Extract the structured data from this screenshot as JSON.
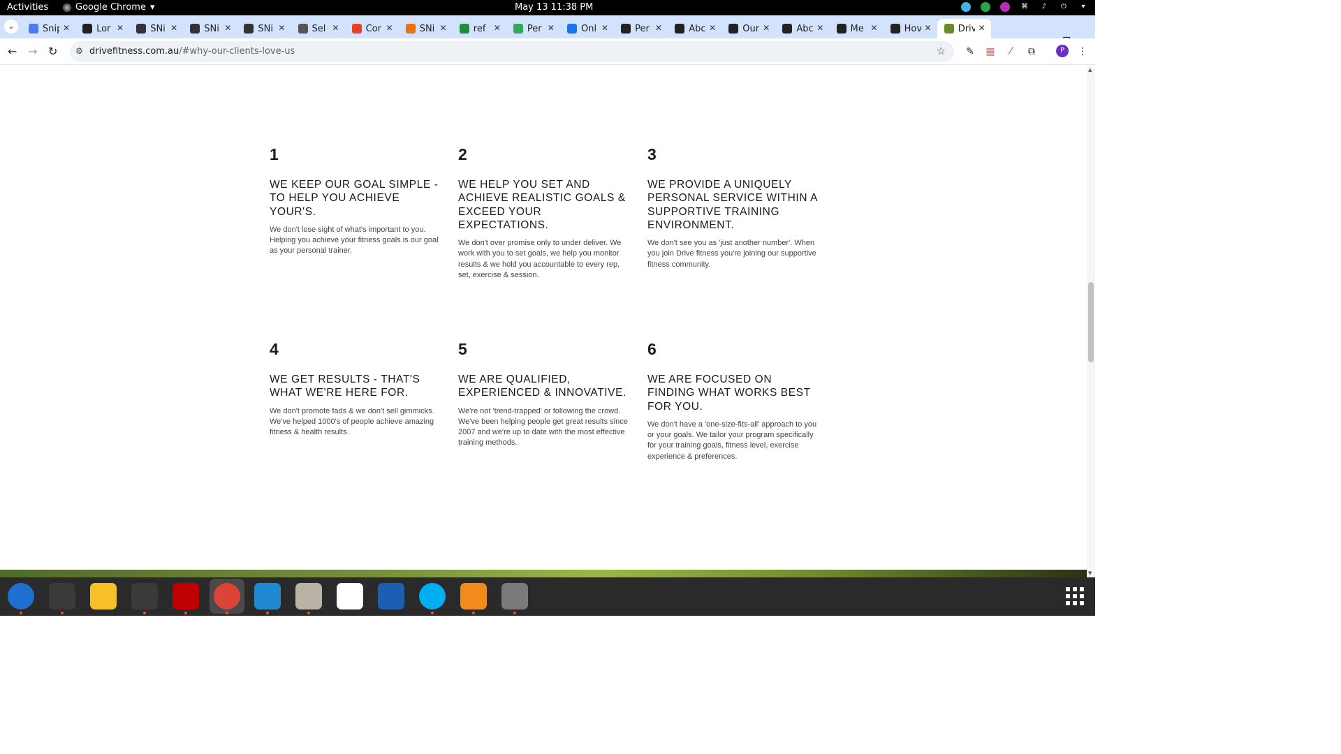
{
  "system_bar": {
    "activities": "Activities",
    "app_name": "Google Chrome",
    "clock": "May 13  11:38 PM"
  },
  "tabs": [
    {
      "label": "Snip",
      "favicon_color": "#4a7cf0"
    },
    {
      "label": "Lor",
      "favicon_color": "#222222"
    },
    {
      "label": "SNi",
      "favicon_color": "#333333"
    },
    {
      "label": "SNi",
      "favicon_color": "#333333"
    },
    {
      "label": "SNi",
      "favicon_color": "#333333"
    },
    {
      "label": "Sel",
      "favicon_color": "#555555"
    },
    {
      "label": "Cor",
      "favicon_color": "#e24329"
    },
    {
      "label": "SNi",
      "favicon_color": "#e9720e"
    },
    {
      "label": "ref",
      "favicon_color": "#1e8e3e"
    },
    {
      "label": "Per",
      "favicon_color": "#34a853"
    },
    {
      "label": "Onl",
      "favicon_color": "#1a73e8"
    },
    {
      "label": "Per",
      "favicon_color": "#222222"
    },
    {
      "label": "Abc",
      "favicon_color": "#222222"
    },
    {
      "label": "Our",
      "favicon_color": "#222222"
    },
    {
      "label": "Abc",
      "favicon_color": "#222222"
    },
    {
      "label": "Me",
      "favicon_color": "#222222"
    },
    {
      "label": "Hov",
      "favicon_color": "#222222"
    },
    {
      "label": "Driv",
      "favicon_color": "#6a8a2a",
      "active": true
    }
  ],
  "address_bar": {
    "domain": "drivefitness.com.au",
    "path": "/#why-our-clients-love-us"
  },
  "profile_initial": "P",
  "features": [
    {
      "number": "1",
      "heading": "WE KEEP OUR GOAL SIMPLE - TO HELP YOU ACHIEVE YOUR'S.",
      "body": "We don't lose sight of what's important to you. Helping you achieve your fitness goals is our goal as your personal trainer."
    },
    {
      "number": "2",
      "heading": "WE HELP YOU SET AND ACHIEVE REALISTIC GOALS & EXCEED YOUR EXPECTATIONS.",
      "body": "We don't over promise only to under deliver. We work with you to set goals, we help you monitor results & we hold you accountable to every rep, set, exercise & session."
    },
    {
      "number": "3",
      "heading": "WE PROVIDE A UNIQUELY PERSONAL SERVICE WITHIN A SUPPORTIVE TRAINING ENVIRONMENT.",
      "body": "We don't see you as 'just another number'. When you join Drive fitness you're joining our supportive fitness community."
    },
    {
      "number": "4",
      "heading": "WE GET RESULTS - THAT'S WHAT WE'RE HERE FOR.",
      "body": "We don't promote fads & we don't sell gimmicks. We've helped 1000's of people achieve amazing fitness & health results."
    },
    {
      "number": "5",
      "heading": "WE ARE QUALIFIED, EXPERIENCED & INNOVATIVE.",
      "body": "We're not 'trend-trapped' or following the crowd. We've been helping people get great results since 2007 and we're up to date with the most effective training methods."
    },
    {
      "number": "6",
      "heading": "WE ARE FOCUSED ON FINDING WHAT WORKS BEST FOR YOU.",
      "body": "We don't have a 'one-size-fits-all' approach to you or your goals. We tailor your program specifically for your training goals, fitness level, exercise experience & preferences."
    }
  ],
  "dock": [
    {
      "name": "thunderbird",
      "color": "#1f6fd0",
      "running": true
    },
    {
      "name": "terminal",
      "color": "#3a3a3a",
      "running": true
    },
    {
      "name": "notes",
      "color": "#f6c026",
      "running": false
    },
    {
      "name": "system-monitor",
      "color": "#3a3a3a",
      "running": true
    },
    {
      "name": "filezilla",
      "color": "#bf0000",
      "running": true
    },
    {
      "name": "chrome",
      "color": "#db4437",
      "running": true,
      "selected": true
    },
    {
      "name": "vscode",
      "color": "#1f8ad2",
      "running": true
    },
    {
      "name": "files",
      "color": "#b9b3a6",
      "running": true
    },
    {
      "name": "text-editor",
      "color": "#ffffff",
      "running": false
    },
    {
      "name": "writer",
      "color": "#1b5fb2",
      "running": false
    },
    {
      "name": "skype",
      "color": "#00aff0",
      "running": true
    },
    {
      "name": "ember",
      "color": "#f28b1c",
      "running": true
    },
    {
      "name": "disk-utility",
      "color": "#7a7a7a",
      "running": true
    }
  ]
}
